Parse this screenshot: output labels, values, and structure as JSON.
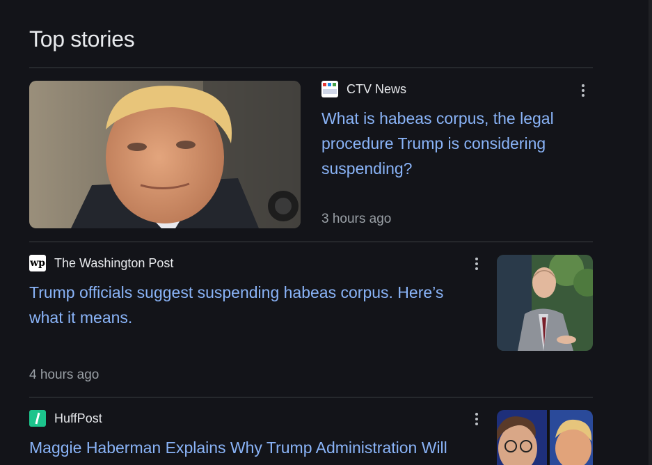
{
  "section": {
    "title": "Top stories"
  },
  "stories": [
    {
      "source": "CTV News",
      "headline": "What is habeas corpus, the legal procedure Trump is considering suspending?",
      "time": "3 hours ago",
      "logo_icon": "ctv-news-logo-icon",
      "image": "trump-portrait-photo"
    },
    {
      "source": "The Washington Post",
      "headline": "Trump officials suggest suspending habeas corpus. Here’s what it means.",
      "time": "4 hours ago",
      "logo_icon": "washington-post-logo-icon",
      "logo_text": "wp",
      "image": "stephen-miller-photo"
    },
    {
      "source": "HuffPost",
      "headline": "Maggie Haberman Explains Why Trump Administration Will",
      "logo_icon": "huffpost-logo-icon",
      "image": "haberman-trump-photo"
    }
  ],
  "colors": {
    "background": "#131419",
    "headline_link": "#8ab4f8",
    "secondary_text": "#9aa0a6",
    "divider": "#3c4043",
    "huffpost_green": "#1cc48c"
  }
}
